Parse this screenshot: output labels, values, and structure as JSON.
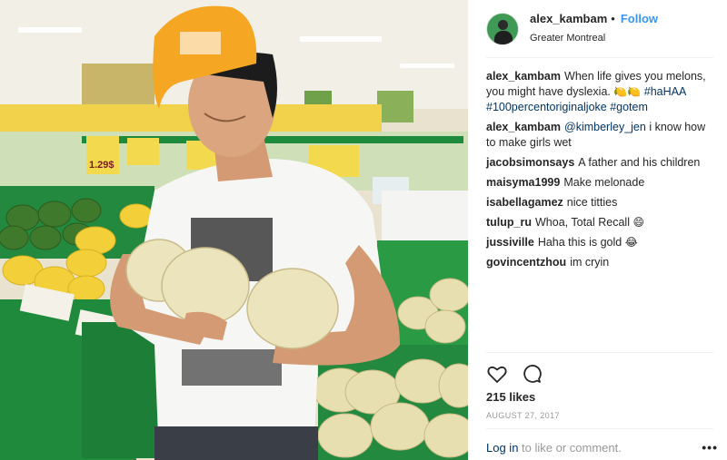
{
  "post": {
    "username": "alex_kambam",
    "dot": "•",
    "follow_label": "Follow",
    "location": "Greater Montreal",
    "likes": "215 likes",
    "date": "AUGUST 27, 2017",
    "login_link": "Log in",
    "login_rest": " to like or comment.",
    "more_glyph": "•••"
  },
  "caption": {
    "user": "alex_kambam",
    "text": "When life gives you melons, you might have dyslexia.",
    "emoji": "🍋🍋",
    "tags": "#haHAA #100percentoriginaljoke #gotem"
  },
  "comments": [
    {
      "user": "alex_kambam",
      "mention": "@kimberley_jen",
      "text": "i know how to make girls wet",
      "emoji": ""
    },
    {
      "user": "jacobsimonsays",
      "mention": "",
      "text": "A father and his children",
      "emoji": ""
    },
    {
      "user": "maisyma1999",
      "mention": "",
      "text": "Make melonade",
      "emoji": ""
    },
    {
      "user": "isabellagamez",
      "mention": "",
      "text": "nice titties",
      "emoji": ""
    },
    {
      "user": "tulup_ru",
      "mention": "",
      "text": "Whoa, Total Recall",
      "emoji": "😄"
    },
    {
      "user": "jussiville",
      "mention": "",
      "text": "Haha this is gold",
      "emoji": "😂"
    },
    {
      "user": "govincentzhou",
      "mention": "",
      "text": "im cryin",
      "emoji": ""
    }
  ],
  "photo": {
    "sign_price": "1.29$",
    "icons": [
      "heart-icon",
      "comment-icon"
    ]
  },
  "colors": {
    "accent": "#3897f0",
    "link": "#003569",
    "muted": "#999999",
    "cap": "#f5a623",
    "shelf": "#1e8a3c"
  }
}
